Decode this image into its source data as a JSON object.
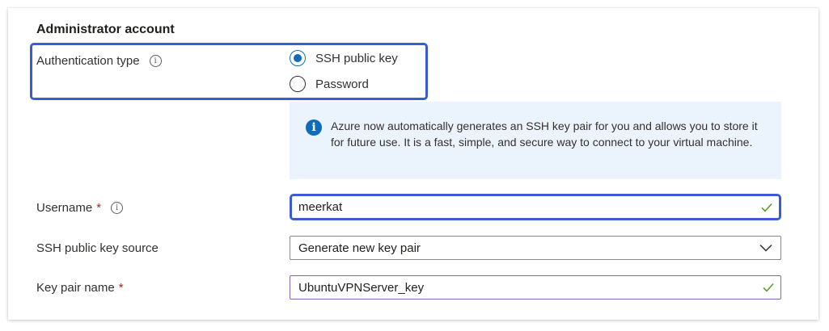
{
  "section": {
    "title": "Administrator account"
  },
  "auth": {
    "label": "Authentication type",
    "info": "i",
    "options": [
      {
        "label": "SSH public key",
        "selected": true
      },
      {
        "label": "Password",
        "selected": false
      }
    ]
  },
  "infobar": {
    "icon": "info-icon",
    "text": "Azure now automatically generates an SSH key pair for you and allows you to store it for future use. It is a fast, simple, and secure way to connect to your virtual machine."
  },
  "username": {
    "label": "Username",
    "required": "*",
    "info": "i",
    "value": "meerkat",
    "valid": true
  },
  "key_source": {
    "label": "SSH public key source",
    "value": "Generate new key pair"
  },
  "key_pair_name": {
    "label": "Key pair name",
    "required": "*",
    "value": "UbuntuVPNServer_key",
    "valid": true
  },
  "colors": {
    "accent": "#0f6cbd",
    "highlight": "#3a5ad6",
    "required": "#a4262c",
    "success": "#5c9c2a",
    "infobar_bg": "#ebf3fc"
  }
}
